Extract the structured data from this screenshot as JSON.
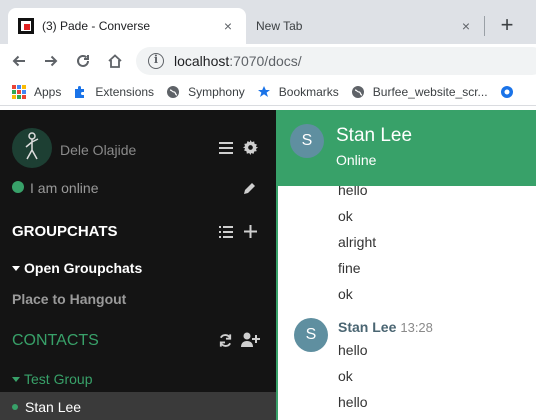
{
  "browser": {
    "tabs": [
      {
        "title": "(3) Pade - Converse",
        "close": "×"
      },
      {
        "title": "New Tab",
        "close": "×"
      }
    ],
    "new_tab": "+",
    "url_host": "localhost",
    "url_path": ":7070/docs/",
    "bookmarks": [
      "Apps",
      "Extensions",
      "Symphony",
      "Bookmarks",
      "Burfee_website_scr..."
    ]
  },
  "sidebar": {
    "user_name": "Dele Olajide",
    "status": "I am online",
    "groupchats_title": "GROUPCHATS",
    "open_groupchats": "Open Groupchats",
    "room": "Place to Hangout",
    "contacts_title": "CONTACTS",
    "group_name": "Test Group",
    "contact": "Stan Lee"
  },
  "chat": {
    "avatar_letter": "S",
    "title": "Stan Lee",
    "status": "Online",
    "messages_top": [
      "hello",
      "ok",
      "alright",
      "fine",
      "ok"
    ],
    "sender": "Stan Lee",
    "time": "13:28",
    "messages_bottom": [
      "hello",
      "ok",
      "hello"
    ]
  },
  "colors": {
    "accent": "#38a169",
    "sidebar_bg": "#141414",
    "avatar": "#5f8fa0"
  }
}
